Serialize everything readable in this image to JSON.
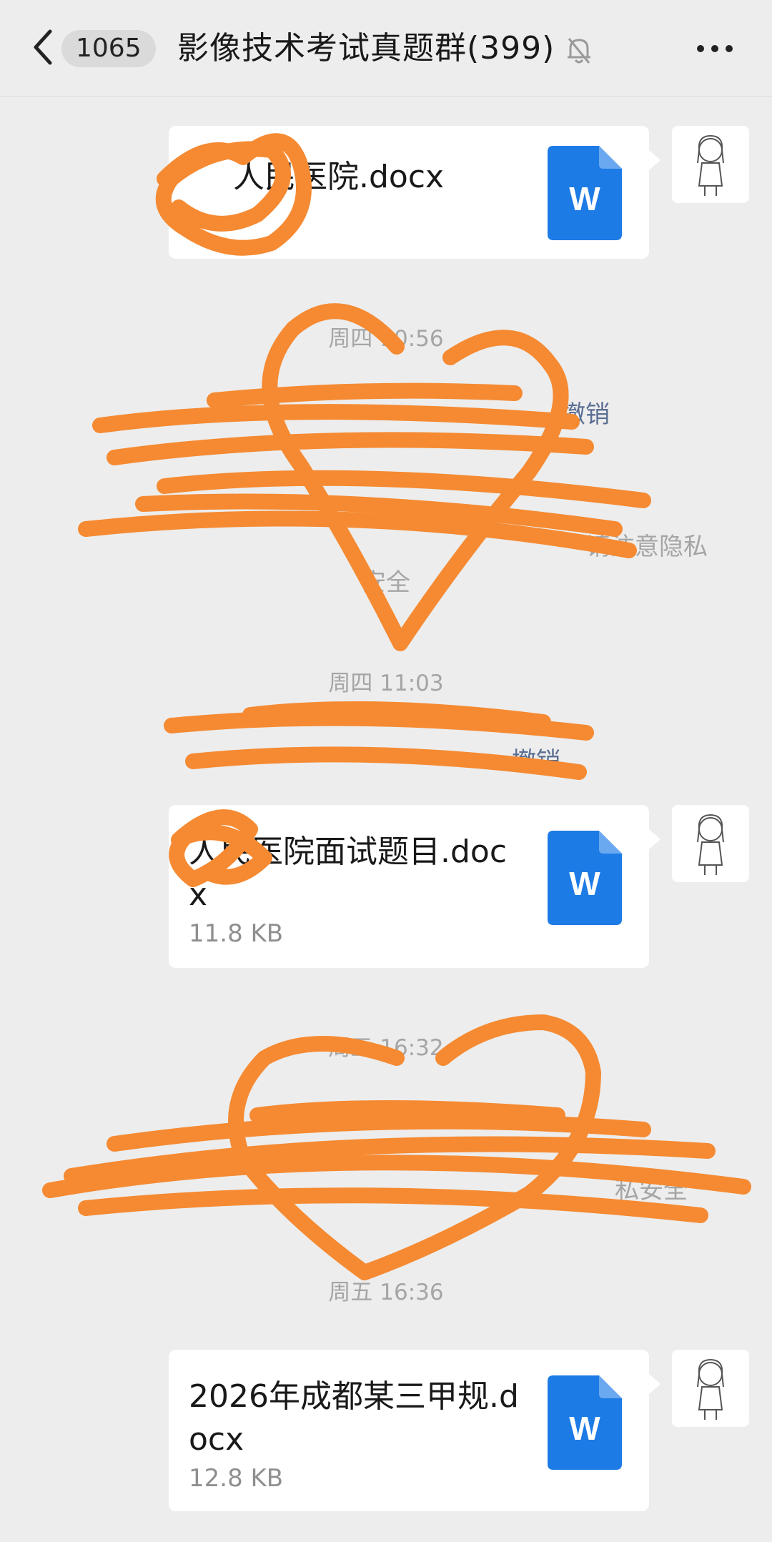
{
  "header": {
    "back_icon": "chevron-left-icon",
    "unread_count": "1065",
    "title": "影像技术考试真题群(399)",
    "mute_icon": "bell-off-icon",
    "more_icon": "more-dots-icon"
  },
  "messages": [
    {
      "type": "file",
      "name": "人民医院.docx",
      "size": ""
    },
    {
      "type": "time",
      "text": "周四 10:56"
    },
    {
      "type": "system",
      "text_fragments": [
        "撤销",
        "请注意隐私",
        "安全"
      ]
    },
    {
      "type": "time",
      "text": "周四 11:03"
    },
    {
      "type": "system",
      "text_fragments": [
        "撤销"
      ]
    },
    {
      "type": "file",
      "name": "人民医院面试题目.docx",
      "size": "11.8 KB"
    },
    {
      "type": "time",
      "text": "周五 16:32"
    },
    {
      "type": "system",
      "text_fragments": [
        "私安全"
      ]
    },
    {
      "type": "time",
      "text": "周五 16:36"
    },
    {
      "type": "file",
      "name": "2026年成都某三甲规.docx",
      "size": "12.8 KB"
    }
  ],
  "file_icon": {
    "name": "word-doc-icon",
    "letter": "W",
    "color": "#1d7be5"
  },
  "redaction_color": "#f58a32"
}
